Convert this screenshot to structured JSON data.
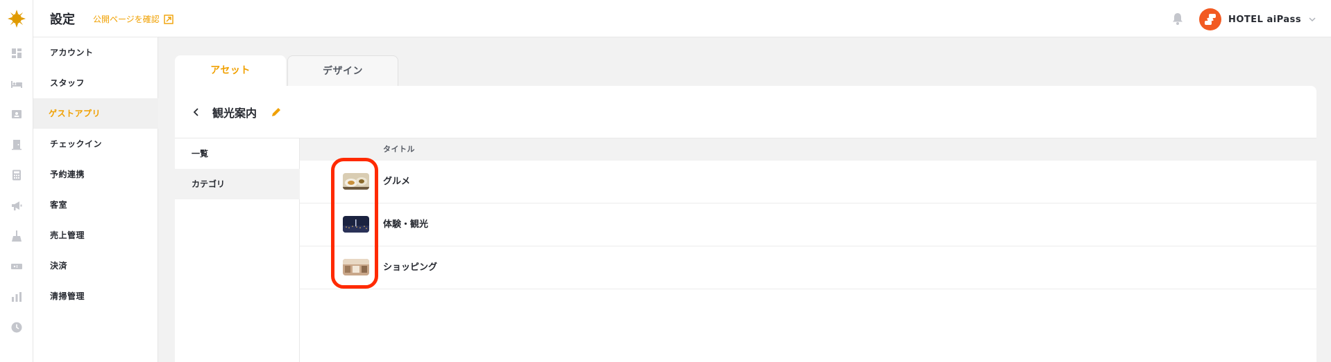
{
  "header": {
    "title": "設定",
    "preview_link": "公開ページを確認",
    "account_name": "HOTEL aiPass"
  },
  "rail_icons": [
    "sun-logo-icon",
    "dashboard-icon",
    "bed-icon",
    "contacts-icon",
    "door-icon",
    "calculator-icon",
    "megaphone-icon",
    "cleaning-icon",
    "ticket-icon",
    "bar-chart-icon",
    "clock-icon"
  ],
  "menu": {
    "items": [
      "アカウント",
      "スタッフ",
      "ゲストアプリ",
      "チェックイン",
      "予約連携",
      "客室",
      "売上管理",
      "決済",
      "清掃管理"
    ],
    "active": "ゲストアプリ"
  },
  "tabs": [
    "アセット",
    "デザイン"
  ],
  "section": {
    "title": "観光案内"
  },
  "sub_nav": [
    "一覧",
    "カテゴリ"
  ],
  "table": {
    "column_title": "タイトル",
    "rows": [
      {
        "title": "グルメ"
      },
      {
        "title": "体験・観光"
      },
      {
        "title": "ショッピング"
      }
    ]
  },
  "colors": {
    "accent": "#f0a000",
    "highlight": "#ff2a00",
    "brand": "#f25a22"
  }
}
